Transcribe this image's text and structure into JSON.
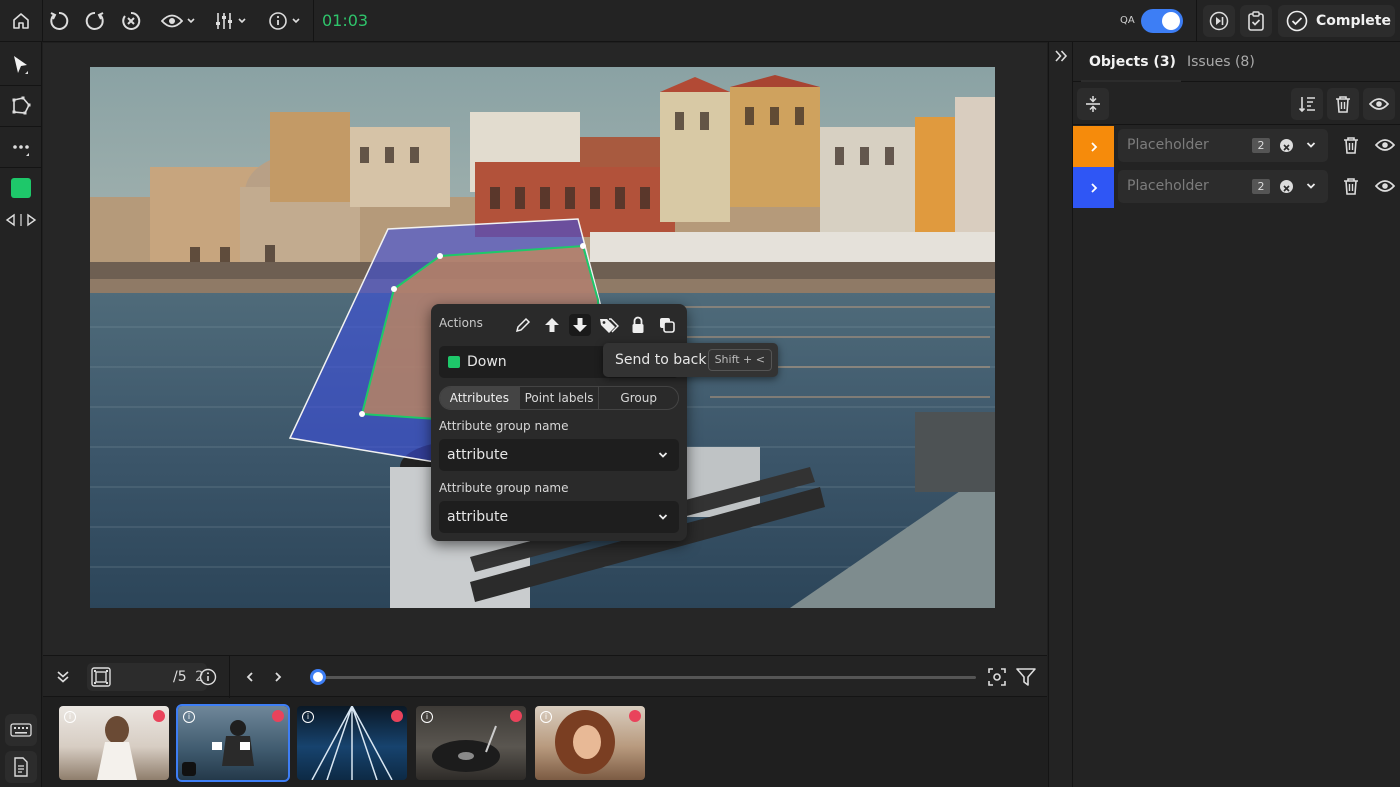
{
  "topbar": {
    "timer": "01:03",
    "qa_label": "QA",
    "complete_label": "Complete"
  },
  "canvas": {
    "annotation_class": "Down",
    "tooltip": {
      "label": "Send to back",
      "shortcut": "Shift + <"
    },
    "actions_popup": {
      "title": "Actions",
      "tabs": [
        "Attributes",
        "Point labels",
        "Group"
      ],
      "active_tab": "Attributes",
      "attributes": [
        {
          "label": "Attribute group name",
          "value": "attribute"
        },
        {
          "label": "Attribute group name",
          "value": "attribute"
        }
      ]
    }
  },
  "framebar": {
    "current_frame": "2",
    "total": "/5"
  },
  "right_panel": {
    "tabs": [
      {
        "label": "Objects (3)",
        "active": true
      },
      {
        "label": "Issues (8)",
        "active": false
      }
    ],
    "objects": [
      {
        "placeholder": "Placeholder",
        "count": "2",
        "color": "#f68b0b"
      },
      {
        "placeholder": "Placeholder",
        "count": "2",
        "color": "#2f56f5"
      }
    ]
  },
  "colors": {
    "accent": "#3d7ef5",
    "class_green": "#1ec86a",
    "timer_green": "#2fc46b",
    "orange": "#f68b0b",
    "blue": "#2f56f5"
  }
}
